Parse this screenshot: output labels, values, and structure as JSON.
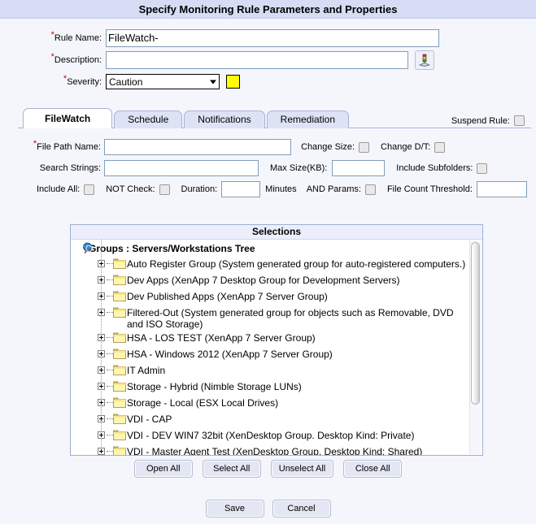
{
  "window": {
    "title": "Specify Monitoring Rule Parameters and Properties"
  },
  "form": {
    "rule_name": {
      "label": "Rule Name:",
      "value": "FileWatch-",
      "required": true
    },
    "description": {
      "label": "Description:",
      "value": "",
      "required": true,
      "button_icon": "severity-lookup-icon"
    },
    "severity": {
      "label": "Severity:",
      "value": "Caution",
      "required": true,
      "swatch_color": "#ffff00",
      "options": [
        "Caution"
      ]
    }
  },
  "tabs": {
    "items": [
      {
        "label": "FileWatch",
        "active": true
      },
      {
        "label": "Schedule",
        "active": false
      },
      {
        "label": "Notifications",
        "active": false
      },
      {
        "label": "Remediation",
        "active": false
      }
    ],
    "suspend_rule_label": "Suspend Rule:",
    "suspend_rule_checked": false
  },
  "filewatch": {
    "file_path_name": {
      "label": "File Path Name:",
      "value": "",
      "required": true
    },
    "change_size": {
      "label": "Change Size:",
      "checked": false
    },
    "change_dt": {
      "label": "Change D/T:",
      "checked": false
    },
    "search_strings": {
      "label": "Search Strings:",
      "value": ""
    },
    "max_size_kb": {
      "label": "Max Size(KB):",
      "value": ""
    },
    "include_subfolders": {
      "label": "Include Subfolders:",
      "checked": false
    },
    "include_all": {
      "label": "Include All:",
      "checked": false
    },
    "not_check": {
      "label": "NOT Check:",
      "checked": false
    },
    "duration": {
      "label": "Duration:",
      "value": "",
      "units": "Minutes"
    },
    "and_params": {
      "label": "AND Params:",
      "checked": false
    },
    "file_count_threshold": {
      "label": "File Count Threshold:",
      "value": ""
    }
  },
  "selections": {
    "header": "Selections",
    "root": {
      "icon": "globe-search-icon",
      "label": "Groups : Servers/Workstations Tree"
    },
    "nodes": [
      {
        "icon": "folder-icon",
        "expander": "plus-icon",
        "label": "Auto Register Group (System generated group for auto-registered computers.)"
      },
      {
        "icon": "folder-icon",
        "expander": "plus-icon",
        "label": "Dev Apps (XenApp 7 Desktop Group for Development Servers)"
      },
      {
        "icon": "folder-icon",
        "expander": "plus-icon",
        "label": "Dev Published Apps (XenApp 7 Server Group)"
      },
      {
        "icon": "folder-icon",
        "expander": "plus-icon",
        "label": "Filtered-Out (System generated group for objects such as Removable, DVD and ISO Storage)"
      },
      {
        "icon": "folder-icon",
        "expander": "plus-icon",
        "label": "HSA - LOS TEST (XenApp 7 Server Group)"
      },
      {
        "icon": "folder-icon",
        "expander": "plus-icon",
        "label": "HSA - Windows 2012 (XenApp 7 Server Group)"
      },
      {
        "icon": "folder-icon",
        "expander": "plus-icon",
        "label": "IT Admin"
      },
      {
        "icon": "folder-icon",
        "expander": "plus-icon",
        "label": "Storage - Hybrid (Nimble Storage LUNs)"
      },
      {
        "icon": "folder-icon",
        "expander": "plus-icon",
        "label": "Storage - Local (ESX Local Drives)"
      },
      {
        "icon": "folder-icon",
        "expander": "plus-icon",
        "label": "VDI - CAP"
      },
      {
        "icon": "folder-icon",
        "expander": "plus-icon",
        "label": "VDI - DEV WIN7 32bit (XenDesktop Group. Desktop Kind: Private)"
      },
      {
        "icon": "folder-icon",
        "expander": "plus-icon",
        "label": "VDI - Master Agent Test (XenDesktop Group. Desktop Kind: Shared)"
      }
    ]
  },
  "tree_buttons": {
    "open_all": "Open All",
    "select_all": "Select All",
    "unselect_all": "Unselect All",
    "close_all": "Close All"
  },
  "footer_buttons": {
    "save": "Save",
    "cancel": "Cancel"
  }
}
